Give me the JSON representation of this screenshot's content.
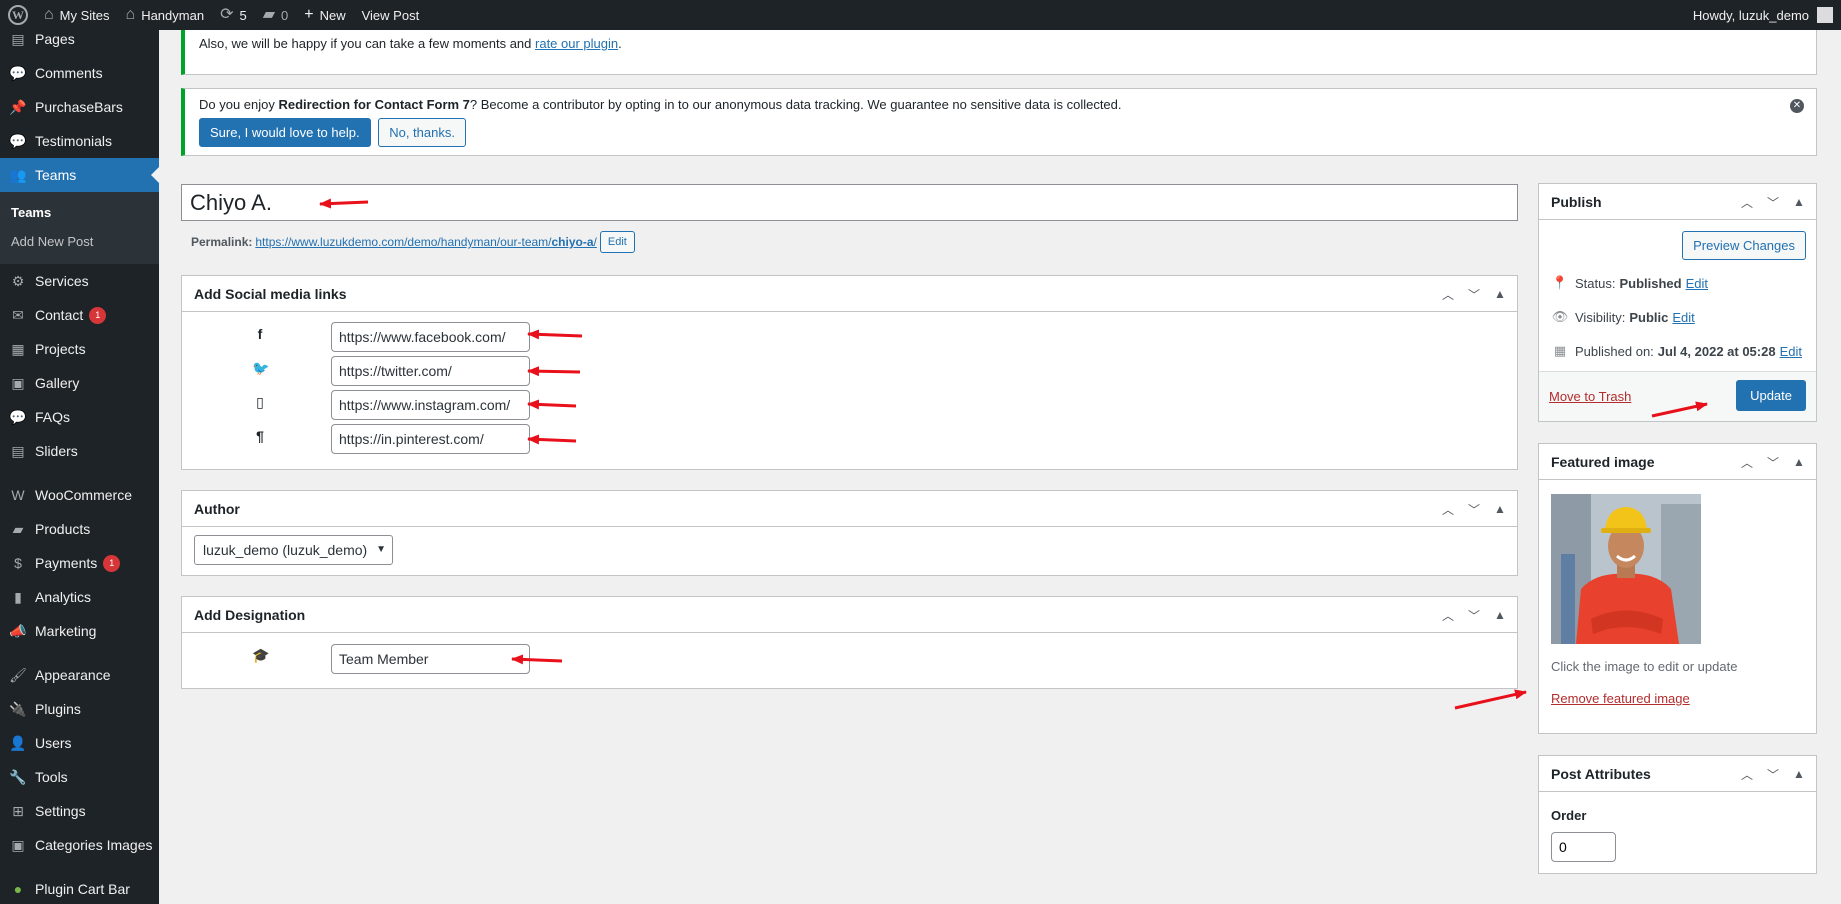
{
  "admin_bar": {
    "my_sites": "My Sites",
    "site_name": "Handyman",
    "updates_count": "5",
    "comments_count": "0",
    "new_label": "New",
    "view_post": "View Post",
    "howdy": "Howdy, luzuk_demo"
  },
  "sidebar": {
    "items_top": [
      {
        "label": "Pages",
        "icon": "pages-icon",
        "glyph": "▤"
      },
      {
        "label": "Comments",
        "icon": "comments-icon",
        "glyph": "💬"
      },
      {
        "label": "PurchaseBars",
        "icon": "pin-icon",
        "glyph": "📌"
      },
      {
        "label": "Testimonials",
        "icon": "testimonials-icon",
        "glyph": "💬"
      }
    ],
    "current": {
      "label": "Teams",
      "icon": "teams-icon",
      "glyph": "👥"
    },
    "submenu": [
      "Teams",
      "Add New Post"
    ],
    "items_mid": [
      {
        "label": "Services",
        "icon": "services-icon",
        "glyph": "⚙"
      },
      {
        "label": "Contact",
        "icon": "mail-icon",
        "glyph": "✉",
        "badge": "1"
      },
      {
        "label": "Projects",
        "icon": "projects-icon",
        "glyph": "▦"
      },
      {
        "label": "Gallery",
        "icon": "gallery-icon",
        "glyph": "▣"
      },
      {
        "label": "FAQs",
        "icon": "faq-icon",
        "glyph": "💬"
      },
      {
        "label": "Sliders",
        "icon": "sliders-icon",
        "glyph": "▤"
      }
    ],
    "items_shop": [
      {
        "label": "WooCommerce",
        "icon": "woocommerce-icon",
        "glyph": "W"
      },
      {
        "label": "Products",
        "icon": "products-icon",
        "glyph": "▰"
      },
      {
        "label": "Payments",
        "icon": "payments-icon",
        "glyph": "$",
        "badge": "1"
      },
      {
        "label": "Analytics",
        "icon": "analytics-icon",
        "glyph": "▮"
      },
      {
        "label": "Marketing",
        "icon": "marketing-icon",
        "glyph": "📣"
      }
    ],
    "items_bottom": [
      {
        "label": "Appearance",
        "icon": "appearance-icon",
        "glyph": "🖌"
      },
      {
        "label": "Plugins",
        "icon": "plugins-icon",
        "glyph": "🔌"
      },
      {
        "label": "Users",
        "icon": "users-icon",
        "glyph": "👤"
      },
      {
        "label": "Tools",
        "icon": "tools-icon",
        "glyph": "🔧"
      },
      {
        "label": "Settings",
        "icon": "settings-icon",
        "glyph": "⊞"
      },
      {
        "label": "Categories Images",
        "icon": "images-icon",
        "glyph": "▣"
      }
    ],
    "plugin_cart_bar": {
      "label": "Plugin Cart Bar",
      "icon": "leaf-icon",
      "glyph": "●"
    }
  },
  "notices": {
    "top_text": "Also, we will be happy if you can take a few moments and ",
    "top_link": "rate our plugin",
    "top_suffix": ".",
    "main_prefix": "Do you enjoy ",
    "main_bold": "Redirection for Contact Form 7",
    "main_suffix": "? Become a contributor by opting in to our anonymous data tracking. We guarantee no sensitive data is collected.",
    "accept_btn": "Sure, I would love to help.",
    "decline_btn": "No, thanks."
  },
  "post": {
    "title": "Chiyo A.",
    "permalink_label": "Permalink:",
    "permalink_base": "https://www.luzukdemo.com/demo/handyman/our-team/",
    "permalink_slug": "chiyo-a",
    "permalink_end": "/",
    "edit_btn": "Edit"
  },
  "social_box": {
    "title": "Add Social media links",
    "links": [
      {
        "icon": "facebook-icon",
        "glyph": "f",
        "value": "https://www.facebook.com/"
      },
      {
        "icon": "twitter-icon",
        "glyph": "🐦",
        "value": "https://twitter.com/"
      },
      {
        "icon": "instagram-icon",
        "glyph": "▯",
        "value": "https://www.instagram.com/"
      },
      {
        "icon": "pinterest-icon",
        "glyph": "¶",
        "value": "https://in.pinterest.com/"
      }
    ]
  },
  "author_box": {
    "title": "Author",
    "selected": "luzuk_demo (luzuk_demo)"
  },
  "designation_box": {
    "title": "Add Designation",
    "value": "Team Member"
  },
  "publish_box": {
    "title": "Publish",
    "preview_btn": "Preview Changes",
    "status_label": "Status:",
    "status_value": "Published",
    "visibility_label": "Visibility:",
    "visibility_value": "Public",
    "published_label": "Published on:",
    "published_value": "Jul 4, 2022 at 05:28",
    "edit": "Edit",
    "trash": "Move to Trash",
    "update": "Update"
  },
  "featured_box": {
    "title": "Featured image",
    "hint": "Click the image to edit or update",
    "remove": "Remove featured image"
  },
  "attributes_box": {
    "title": "Post Attributes",
    "order_label": "Order",
    "order_value": "0"
  },
  "colors": {
    "admin_dark": "#1d2327",
    "accent_blue": "#2271b1",
    "notice_green": "#00a32a",
    "annotation_red": "#e8101a"
  }
}
